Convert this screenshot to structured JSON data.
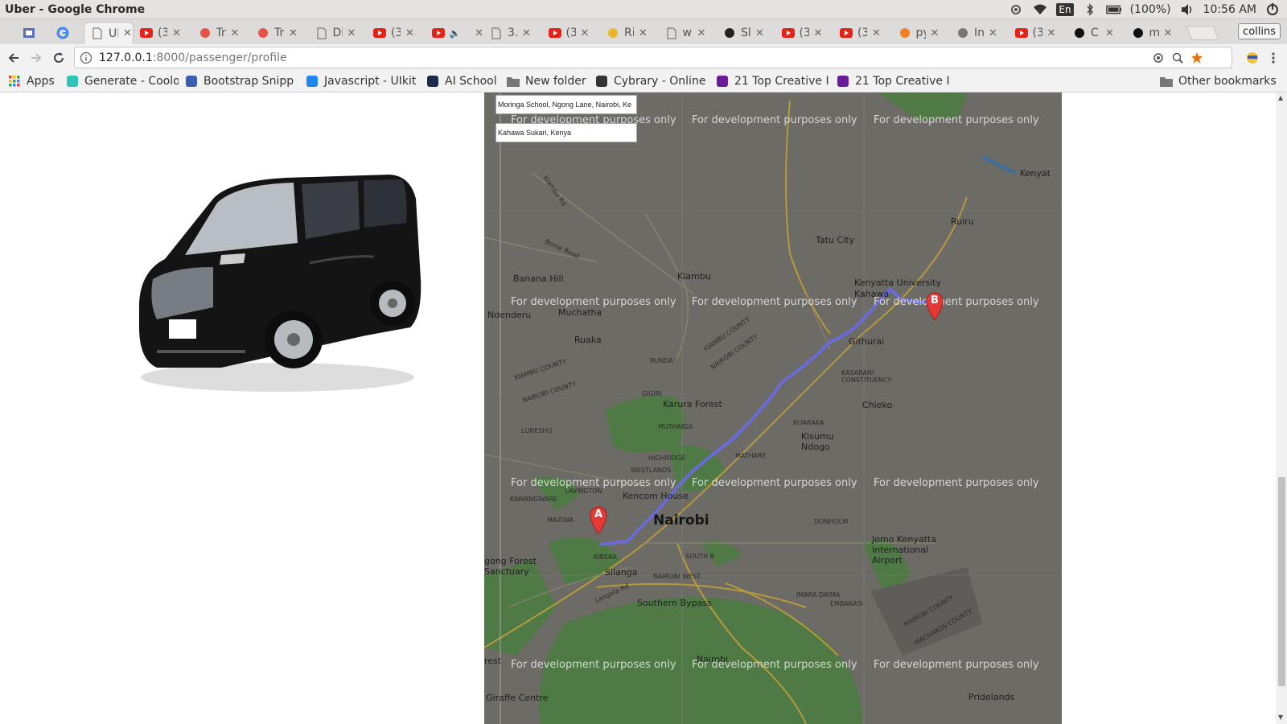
{
  "window": {
    "title": "Uber - Google Chrome"
  },
  "tray": {
    "lang": "En",
    "battery": "(100%)",
    "time": "10:56 AM"
  },
  "tabs": [
    {
      "label": "Ul",
      "icon": "page-icon",
      "active": true
    },
    {
      "label": "(3",
      "icon": "youtube-icon"
    },
    {
      "label": "Tr",
      "icon": "trello-icon"
    },
    {
      "label": "Tr",
      "icon": "trello-icon"
    },
    {
      "label": "Di",
      "icon": "page-icon"
    },
    {
      "label": "(3",
      "icon": "youtube-icon"
    },
    {
      "label": "",
      "icon": "youtube-icon",
      "audio": true
    },
    {
      "label": "3.",
      "icon": "page-icon"
    },
    {
      "label": "(3",
      "icon": "youtube-icon"
    },
    {
      "label": "Ri",
      "icon": "yellow-icon"
    },
    {
      "label": "w",
      "icon": "page-icon"
    },
    {
      "label": "Sl",
      "icon": "dark-icon"
    },
    {
      "label": "(3",
      "icon": "youtube-icon"
    },
    {
      "label": "(3",
      "icon": "youtube-icon"
    },
    {
      "label": "py",
      "icon": "stackoverflow-icon"
    },
    {
      "label": "In",
      "icon": "pin-icon"
    },
    {
      "label": "(3",
      "icon": "youtube-icon"
    },
    {
      "label": "C",
      "icon": "github-icon"
    },
    {
      "label": "m",
      "icon": "github-icon"
    }
  ],
  "profile": {
    "name": "collins"
  },
  "url": {
    "host": "127.0.0.1",
    "path": ":8000/passenger/profile"
  },
  "bookmarks": [
    {
      "label": "Apps",
      "icon": "apps-grid-icon"
    },
    {
      "label": "Generate - Coolo",
      "icon": "coolors-icon"
    },
    {
      "label": "Bootstrap Snipp",
      "icon": "bootstrap-icon"
    },
    {
      "label": "Javascript - UIkit",
      "icon": "uikit-icon"
    },
    {
      "label": "AI School",
      "icon": "aischool-icon"
    },
    {
      "label": "New folder",
      "icon": "folder-icon"
    },
    {
      "label": "Cybrary - Online",
      "icon": "cybrary-icon"
    },
    {
      "label": "21 Top Creative I",
      "icon": "colorlib-icon"
    },
    {
      "label": "21 Top Creative I",
      "icon": "colorlib-icon"
    }
  ],
  "other_bookmarks": "Other bookmarks",
  "map": {
    "origin_input": "Moringa School, Ngong Lane, Nairobi, Ke",
    "destination_input": "Kahawa Sukari, Kenya",
    "watermark": "For development purposes only",
    "marker_a": "A",
    "marker_b": "B",
    "labels": {
      "tatu_city": "Tatu City",
      "ruiru": "Ruiru",
      "kenyatta_university": "Kenyatta University",
      "kahawa": "Kahawa",
      "githurai": "Githurai",
      "banana_hill": "Banana Hill",
      "kiambu": "Kiambu",
      "muchatha": "Muchatha",
      "ndenderu": "Ndenderu",
      "ruaka": "Ruaka",
      "karura_forest": "Karura Forest",
      "chieko": "Chieko",
      "kisumu_ndogo": "Kisumu\nNdogo",
      "kencom_house": "Kencom House",
      "nairobi": "Nairobi",
      "jomo_kenyatta": "Jomo Kenyatta\nInternational\nAirport",
      "silanga": "Silanga",
      "ngong_forest": "gong Forest\nSanctuary",
      "southern_bypass": "Southern Bypass",
      "giraffe_centre": "Giraffe Centre",
      "pridelands": "Pridelands",
      "kenyatta_r": "Kenyat",
      "kiambu_rd": "Kiambu Rd",
      "bome_road": "Bome Road",
      "langata_rd": "Langata Rd",
      "rest": "rest",
      "runda": "RUNDA",
      "gigiri": "GIGIRI",
      "muthaiga": "MUTHAIGA",
      "highridge": "HIGHRIDGE",
      "westlands": "WESTLANDS",
      "lavington": "LAVINGTON",
      "kawangware": "KAWANGWARE",
      "maziwa": "MAZIWA",
      "kibera": "KIBERA",
      "south_b": "SOUTH B",
      "nairobi_west": "NAIROBI WEST",
      "mathare": "MATHARE",
      "ruaraka": "RUARAKA",
      "kasarani": "KASARANI\nCONSTITUENCY",
      "donholm": "DONHOLM",
      "imara_daima": "IMARA DAIMA",
      "embakasi": "EMBAKASI",
      "loresho": "LORESHO",
      "kiambu_county": "KIAMBU COUNTY",
      "nairobi_county": "NAIROBI COUNTY",
      "machakos_county": "MACHAKOS COUNTY",
      "nairobi_s": "Nairobi"
    }
  }
}
